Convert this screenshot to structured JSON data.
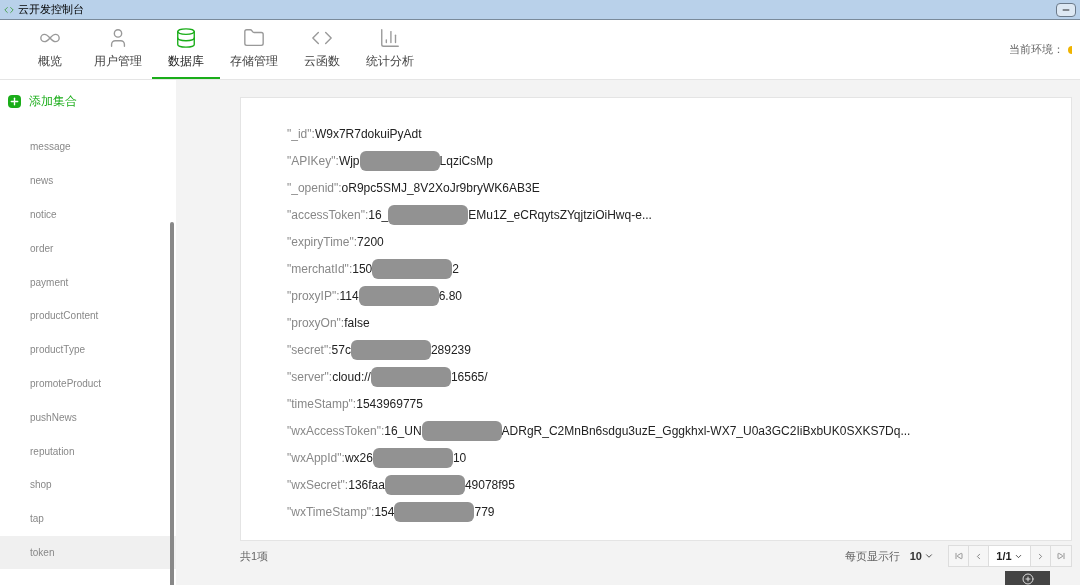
{
  "window": {
    "title": "云开发控制台"
  },
  "tabs": [
    {
      "label": "概览",
      "selected": false
    },
    {
      "label": "用户管理",
      "selected": false
    },
    {
      "label": "数据库",
      "selected": true
    },
    {
      "label": "存储管理",
      "selected": false
    },
    {
      "label": "云函数",
      "selected": false
    },
    {
      "label": "统计分析",
      "selected": false
    }
  ],
  "environment": {
    "label": "当前环境："
  },
  "sidebar": {
    "add_button": "添加集合",
    "items": [
      {
        "label": "message",
        "selected": false
      },
      {
        "label": "news",
        "selected": false
      },
      {
        "label": "notice",
        "selected": false
      },
      {
        "label": "order",
        "selected": false
      },
      {
        "label": "payment",
        "selected": false
      },
      {
        "label": "productContent",
        "selected": false
      },
      {
        "label": "productType",
        "selected": false
      },
      {
        "label": "promoteProduct",
        "selected": false
      },
      {
        "label": "pushNews",
        "selected": false
      },
      {
        "label": "reputation",
        "selected": false
      },
      {
        "label": "shop",
        "selected": false
      },
      {
        "label": "tap",
        "selected": false
      },
      {
        "label": "token",
        "selected": true
      }
    ]
  },
  "record": {
    "fields": [
      {
        "key": "\"_id\":",
        "value": "W9x7R7dokuiPyAdt",
        "redacted": false
      },
      {
        "key": "\"APIKey\":",
        "value": "Wjp",
        "value_end": "LqziCsMp",
        "redacted": true
      },
      {
        "key": "\"_openid\":",
        "value": "oR9pc5SMJ_8V2XoJr9bryWK6AB3E",
        "redacted": false
      },
      {
        "key": "\"accessToken\":",
        "value": "16_",
        "value_end": "EMu1Z_eCRqytsZYqjtziOiHwq-e...",
        "redacted": true
      },
      {
        "key": "\"expiryTime\":",
        "value": "7200",
        "redacted": false
      },
      {
        "key": "\"merchatId\":",
        "value": "150",
        "value_end": "2",
        "redacted": true
      },
      {
        "key": "\"proxyIP\":",
        "value": "114",
        "value_end": "6.80",
        "redacted": true
      },
      {
        "key": "\"proxyOn\":",
        "value": "false",
        "redacted": false
      },
      {
        "key": "\"secret\":",
        "value": "57c",
        "value_end": "289239",
        "redacted": true
      },
      {
        "key": "\"server\":",
        "value": "cloud://",
        "value_end": "16565/",
        "redacted": true
      },
      {
        "key": "\"timeStamp\":",
        "value": "1543969775",
        "redacted": false
      },
      {
        "key": "\"wxAccessToken\":",
        "value": "16_UN",
        "value_end": "ADRgR_C2MnBn6sdgu3uzE_Gggkhxl-WX7_U0a3GC2IiBxbUK0SXKS7Dq...",
        "redacted": true
      },
      {
        "key": "\"wxAppId\":",
        "value": "wx26",
        "value_end": "10",
        "redacted": true
      },
      {
        "key": "\"wxSecret\":",
        "value": "136faa",
        "value_end": "49078f95",
        "redacted": true
      },
      {
        "key": "\"wxTimeStamp\":",
        "value": "154",
        "value_end": "779",
        "redacted": true
      }
    ]
  },
  "footer": {
    "total": "共1项",
    "page_size_label": "每页显示行",
    "page_size": "10",
    "page": "1/1"
  }
}
